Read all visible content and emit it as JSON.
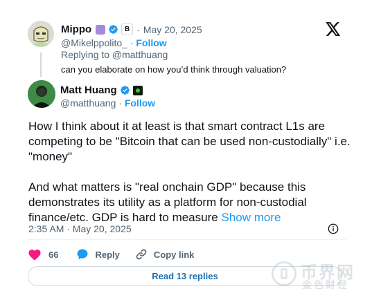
{
  "reply": {
    "author_name": "Mippo",
    "handle": "@Mikelppolito_",
    "follow_label": "Follow",
    "separator": "·",
    "date": "May 20, 2025",
    "replying_to": "Replying to @matthuang",
    "text": "can you elaborate on how you’d think through valuation?"
  },
  "tweet": {
    "author_name": "Matt Huang",
    "handle": "@matthuang",
    "follow_label": "Follow",
    "separator": "·",
    "paragraph_1": "How I think about it at least is that smart contract L1s are competing to be \"Bitcoin that can be used non-custodially\" i.e. \"money\"",
    "paragraph_2": "And what matters is \"real onchain GDP\" because this demonstrates its utility as a platform for non-custodial finance/etc. GDP is hard to measure",
    "show_more": "Show more",
    "timestamp": "2:35 AM · May 20, 2025"
  },
  "actions": {
    "like_count": "66",
    "reply_label": "Reply",
    "copy_link_label": "Copy link",
    "read_replies_label": "Read 13 replies"
  },
  "watermark": {
    "line1": "币界网",
    "line2": "金色财经"
  },
  "icons": {
    "logo": "x-logo-icon",
    "verified": "verified-check-icon",
    "like": "heart-icon",
    "reply": "speech-bubble-icon",
    "copy": "link-icon",
    "info": "info-icon"
  },
  "colors": {
    "accent_blue": "#1d9bf0",
    "like_red": "#f91880",
    "muted_text": "#536471",
    "text": "#0f1419",
    "border": "#cfd9de"
  }
}
